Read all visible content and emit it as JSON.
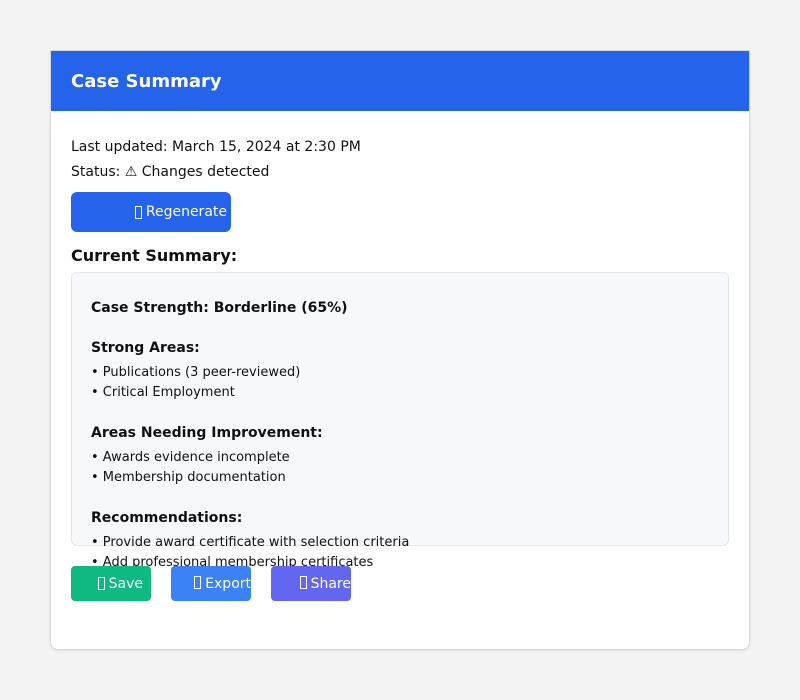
{
  "header": {
    "title": "Case Summary"
  },
  "meta": {
    "last_updated": "Last updated: March 15, 2024 at 2:30 PM",
    "status": "Status: ⚠ Changes detected"
  },
  "regenerate_button": {
    "label": "Regenerate",
    "icon": "refresh-icon"
  },
  "current_summary_heading": "Current Summary:",
  "summary": {
    "strength": "Case Strength: Borderline (65%)",
    "strong_areas": {
      "heading": "Strong Areas:",
      "items": [
        "• Publications (3 peer-reviewed)",
        "• Critical Employment"
      ]
    },
    "improvement_areas": {
      "heading": "Areas Needing Improvement:",
      "items": [
        "• Awards evidence incomplete",
        "• Membership documentation"
      ]
    },
    "recommendations": {
      "heading": "Recommendations:",
      "items": [
        "• Provide award certificate with selection criteria",
        "• Add professional membership certificates"
      ]
    }
  },
  "actions": {
    "save": {
      "label": "Save",
      "icon": "save-icon",
      "color": "#10b981"
    },
    "export": {
      "label": "Export",
      "icon": "export-icon",
      "color": "#3b82f6"
    },
    "share": {
      "label": "Share",
      "icon": "share-icon",
      "color": "#6366f1"
    }
  },
  "colors": {
    "primary": "#2563eb",
    "page_background": "#f3f3f3",
    "summary_background": "#f7f8fa"
  }
}
